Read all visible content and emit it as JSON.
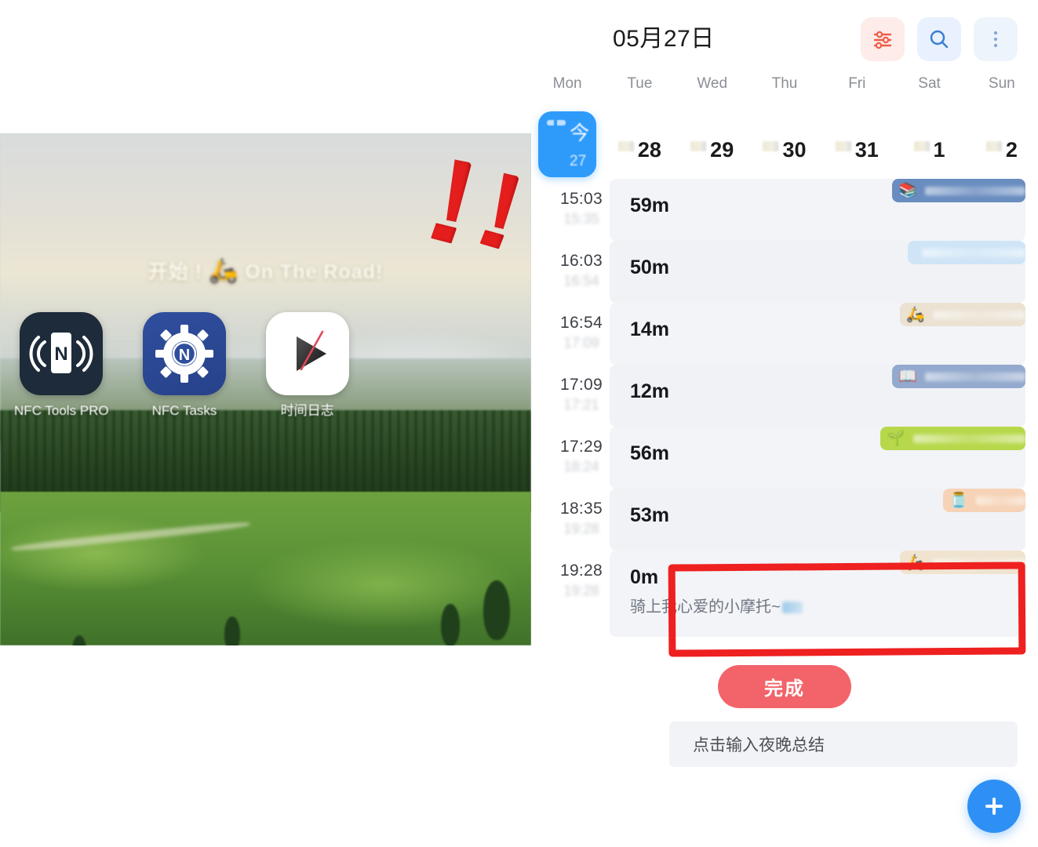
{
  "left_screenshot": {
    "wallpaper_text": "开始 ! ",
    "wallpaper_text_tail": " On The Road!",
    "wallpaper_scooter_icon": "🛵",
    "apps": [
      {
        "label": "NFC Tools PRO",
        "icon": "nfc-tools-pro-icon",
        "letter": "N"
      },
      {
        "label": "NFC Tasks",
        "icon": "nfc-tasks-icon",
        "letter": "N"
      },
      {
        "label": "时间日志",
        "icon": "time-log-icon",
        "letter": ""
      }
    ]
  },
  "app": {
    "header": {
      "date": "05月27日",
      "actions": [
        {
          "name": "filter-icon",
          "label": "筛选"
        },
        {
          "name": "search-icon",
          "label": "搜索"
        },
        {
          "name": "more-icon",
          "label": "更多"
        }
      ]
    },
    "week": {
      "days": [
        "Mon",
        "Tue",
        "Wed",
        "Thu",
        "Fri",
        "Sat",
        "Sun"
      ],
      "dates": [
        {
          "num": "27",
          "today_label": "今",
          "is_today": true
        },
        {
          "num": "28",
          "is_today": false
        },
        {
          "num": "29",
          "is_today": false
        },
        {
          "num": "30",
          "is_today": false
        },
        {
          "num": "31",
          "is_today": false
        },
        {
          "num": "1",
          "is_today": false
        },
        {
          "num": "2",
          "is_today": false
        }
      ]
    },
    "timeline": [
      {
        "start": "15:03",
        "end": "15:35",
        "duration": "59m",
        "note": "",
        "tag_emoji": "📚",
        "tag_color": "#6a8dc0"
      },
      {
        "start": "16:03",
        "end": "16:54",
        "duration": "50m",
        "note": "",
        "tag_emoji": "",
        "tag_color": "#cfe5f7"
      },
      {
        "start": "16:54",
        "end": "17:09",
        "duration": "14m",
        "note": "",
        "tag_emoji": "🛵",
        "tag_color": "#ebe2d2"
      },
      {
        "start": "17:09",
        "end": "17:21",
        "duration": "12m",
        "note": "",
        "tag_emoji": "📖",
        "tag_color": "#93aace"
      },
      {
        "start": "17:29",
        "end": "18:24",
        "duration": "56m",
        "note": "",
        "tag_emoji": "🌱",
        "tag_color": "#b7d84a"
      },
      {
        "start": "18:35",
        "end": "19:28",
        "duration": "53m",
        "note": "",
        "tag_emoji": "🫙",
        "tag_color": "#f6d3b6"
      },
      {
        "start": "19:28",
        "end": "19:28",
        "duration": "0m",
        "note": "骑上我心爱的小摩托~",
        "tag_emoji": "🛵",
        "tag_color": "#f0e3cf",
        "highlighted": true
      }
    ],
    "done_button": "完成",
    "summary_placeholder": "点击输入夜晚总结",
    "fab": {
      "name": "add-button",
      "label": "+"
    }
  },
  "annotations": {
    "exclamation_marks": 4,
    "highlight_color": "#ee2020"
  },
  "colors": {
    "accent_blue": "#2e9bfb",
    "done_red": "#f2646a",
    "annotation_red": "#e41d1d",
    "card_bg": "#f3f4f7"
  }
}
